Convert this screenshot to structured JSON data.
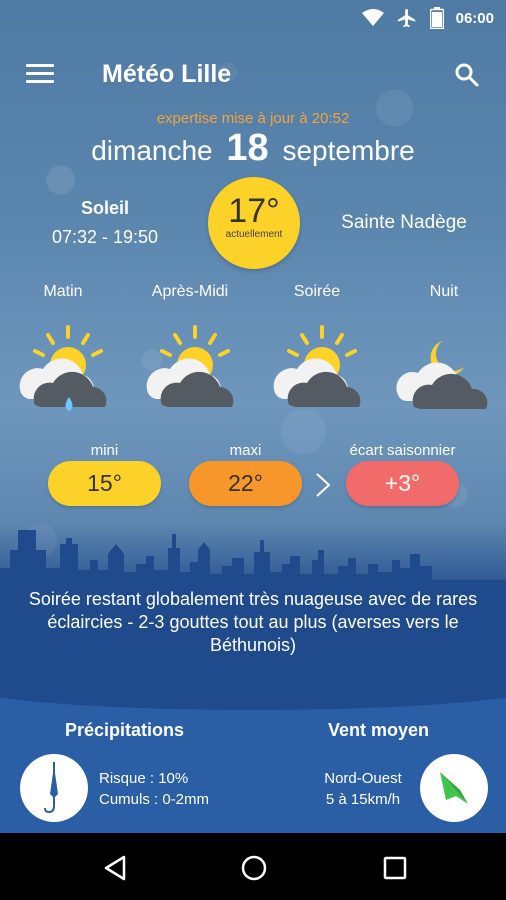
{
  "status": {
    "time": "06:00",
    "icons": [
      "wifi-icon",
      "airplane-icon",
      "battery-icon"
    ]
  },
  "appbar": {
    "title": "Météo Lille",
    "menu_icon": "menu-icon",
    "search_icon": "search-icon"
  },
  "updated": "expertise mise à jour à 20:52",
  "date": {
    "weekday": "dimanche",
    "day": "18",
    "month": "septembre"
  },
  "sun": {
    "title": "Soleil",
    "hours": "07:32 - 19:50"
  },
  "current": {
    "temp": "17°",
    "caption": "actuellement"
  },
  "saint": "Sainte Nadège",
  "periods": [
    {
      "label": "Matin",
      "icon": "sun-cloud-rain-icon"
    },
    {
      "label": "Après-Midi",
      "icon": "sun-clouds-icon"
    },
    {
      "label": "Soirée",
      "icon": "sun-clouds-icon"
    },
    {
      "label": "Nuit",
      "icon": "moon-clouds-icon"
    }
  ],
  "temps": {
    "min_label": "mini",
    "min_value": "15°",
    "max_label": "maxi",
    "max_value": "22°",
    "ecart_label": "écart saisonnier",
    "ecart_value": "+3°"
  },
  "forecast": "Soirée restant globalement très nuageuse avec de rares éclaircies - 2-3 gouttes tout au plus (averses vers le Béthunois)",
  "precip": {
    "title": "Précipitations",
    "risk": "Risque : 10%",
    "cumul": "Cumuls : 0-2mm"
  },
  "wind": {
    "title": "Vent moyen",
    "direction": "Nord-Ouest",
    "speed": "5 à 15km/h"
  },
  "colors": {
    "yellow": "#fdd228",
    "orange": "#f7962b",
    "red": "#f26b6b",
    "accent_orange": "#f4a43a",
    "navy": "#1f4a8c",
    "wind_green": "#3ec54a"
  }
}
